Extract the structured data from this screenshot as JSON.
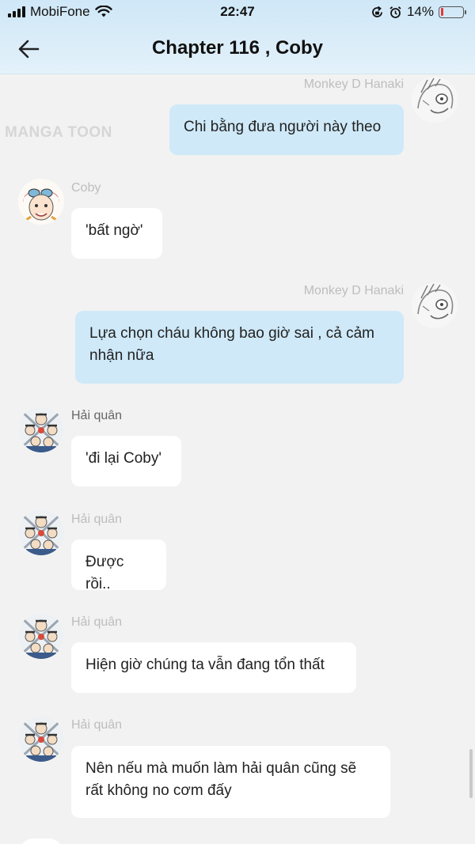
{
  "status_bar": {
    "carrier": "MobiFone",
    "time": "22:47",
    "battery": "14%",
    "battery_level": 0.14,
    "battery_color": "#e53935"
  },
  "header": {
    "title": "Chapter 116 , Coby",
    "back_icon": "arrow-left-icon"
  },
  "watermark": "MANGA TOON",
  "colors": {
    "header_bg": "#d6ebf8",
    "outgoing_bubble": "#cfe9f8",
    "incoming_bubble": "#ffffff",
    "background": "#f2f2f2"
  },
  "messages": [
    {
      "sender": "Monkey D Hanaki",
      "text": "Chi bằng đưa người này theo",
      "side": "right"
    },
    {
      "sender": "Coby",
      "text": "'bất ngờ'",
      "side": "left"
    },
    {
      "sender": "Monkey D Hanaki",
      "text": "Lựa chọn cháu không bao giờ sai , cả cảm nhận nữa",
      "side": "right"
    },
    {
      "sender": "Hải quân",
      "text": "'đi lại Coby'",
      "side": "left"
    },
    {
      "sender": "Hải quân",
      "text": "Được rồi..",
      "side": "left"
    },
    {
      "sender": "Hải quân",
      "text": "Hiện giờ chúng ta vẫn đang tổn thất",
      "side": "left"
    },
    {
      "sender": "Hải quân",
      "text": "Nên nếu mà muốn làm hải quân cũng sẽ rất không no cơm đấy",
      "side": "left"
    }
  ]
}
